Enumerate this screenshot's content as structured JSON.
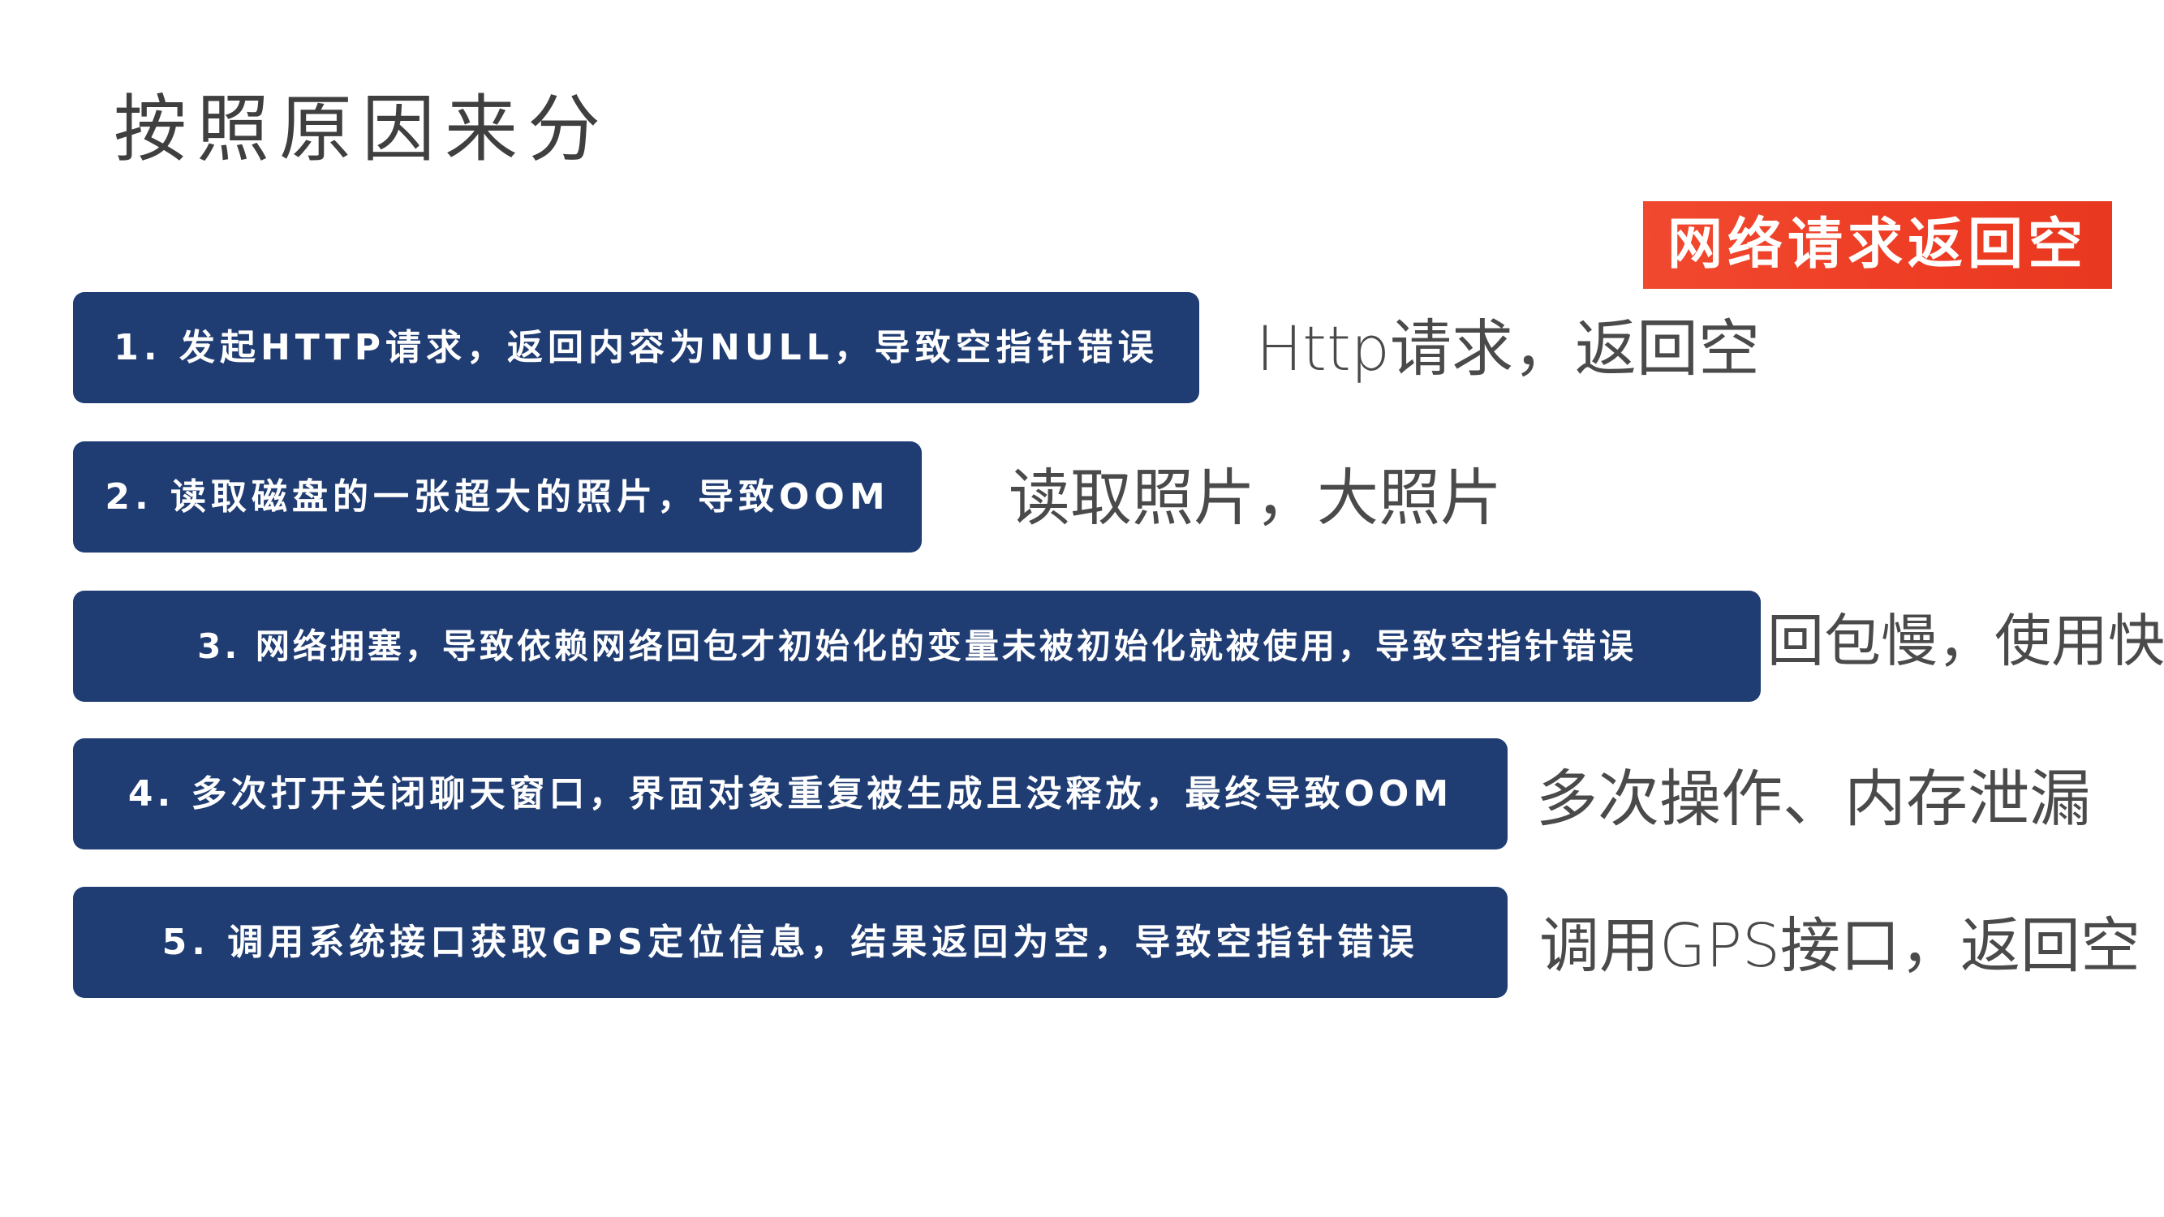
{
  "title": "按照原因来分",
  "tag": "网络请求返回空",
  "rows": [
    {
      "text": "1. 发起HTTP请求，返回内容为NULL，导致空指针错误",
      "note": "Http请求，返回空"
    },
    {
      "text": "2. 读取磁盘的一张超大的照片，导致OOM",
      "note": "读取照片，大照片"
    },
    {
      "text": "3. 网络拥塞，导致依赖网络回包才初始化的变量未被初始化就被使用，导致空指针错误",
      "note": "回包慢，使用快"
    },
    {
      "text": "4. 多次打开关闭聊天窗口，界面对象重复被生成且没释放，最终导致OOM",
      "note": "多次操作、内存泄漏"
    },
    {
      "text": "5. 调用系统接口获取GPS定位信息，结果返回为空，导致空指针错误",
      "note": "调用GPS接口，返回空"
    }
  ],
  "colors": {
    "box": "#1f3c73",
    "tag": "#ee3d24",
    "title": "#3f3f3f",
    "note": "#4a4a4a"
  }
}
